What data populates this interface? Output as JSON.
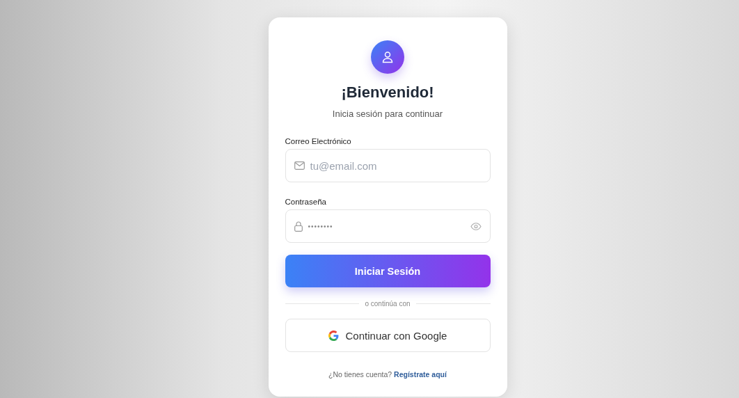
{
  "card": {
    "title": "¡Bienvenido!",
    "subtitle": "Inicia sesión para continuar"
  },
  "fields": [
    {
      "kind": "email",
      "label": "Correo Electrónico",
      "placeholder": "tu@email.com"
    },
    {
      "kind": "password",
      "label": "Contraseña",
      "value": "••••••••"
    }
  ],
  "submit_button": "Iniciar Sesión",
  "divider": "o continúa con",
  "google_button": "Continuar con Google",
  "footer": {
    "text": "¿No tienes cuenta?",
    "link": "Regístrate aquí"
  }
}
